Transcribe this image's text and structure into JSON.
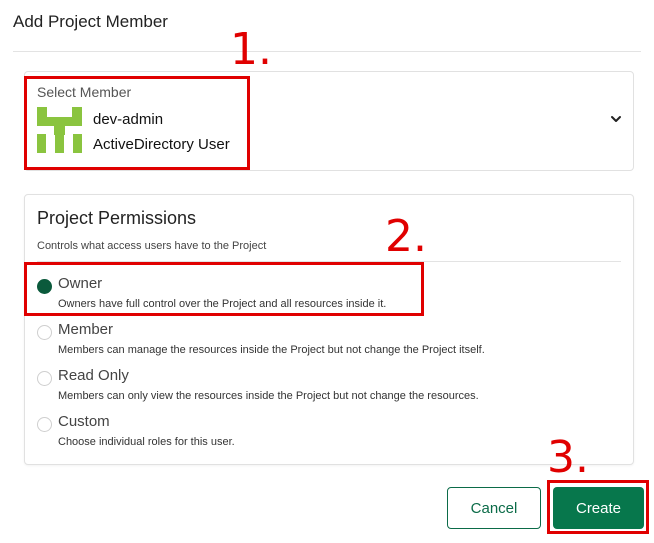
{
  "dialog": {
    "title": "Add Project Member"
  },
  "member": {
    "label": "Select Member",
    "name": "dev-admin",
    "type": "ActiveDirectory User",
    "avatar_icon": "green-identicon",
    "avatar_color": "#8ac43f"
  },
  "permissions": {
    "title": "Project Permissions",
    "subtitle": "Controls what access users have to the Project",
    "selected": "Owner",
    "options": [
      {
        "label": "Owner",
        "description": "Owners have full control over the Project and all resources inside it.",
        "checked": true
      },
      {
        "label": "Member",
        "description": "Members can manage the resources inside the Project but not change the Project itself.",
        "checked": false
      },
      {
        "label": "Read Only",
        "description": "Members can only view the resources inside the Project but not change the resources.",
        "checked": false
      },
      {
        "label": "Custom",
        "description": "Choose individual roles for this user.",
        "checked": false
      }
    ]
  },
  "buttons": {
    "cancel": "Cancel",
    "create": "Create"
  },
  "annotations": {
    "step1": "1.",
    "step2": "2.",
    "step3": "3.",
    "color": "#e00000"
  },
  "colors": {
    "accent": "#07774c",
    "radio_checked": "#0b5a3c"
  }
}
